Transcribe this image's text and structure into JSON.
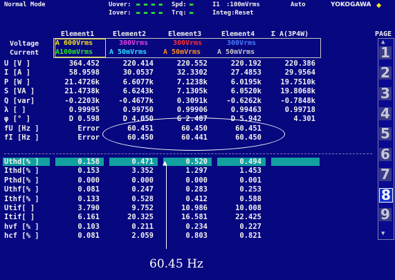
{
  "header": {
    "mode": "Normal Mode",
    "uover_label": "Uover:",
    "iover_label": "Iover:",
    "spd_label": "Spd:",
    "trq_label": "Trq:",
    "range_ch": "I1",
    "range_val": ":100mVrms",
    "auto": "Auto",
    "integ": "Integ:Reset",
    "brand": "YOKOGAWA",
    "brand_mark": "◆"
  },
  "columns": [
    "Element1",
    "Element2",
    "Element3",
    "Element4",
    "Σ A(3P4W)"
  ],
  "ranges": {
    "voltage_label": "Voltage",
    "current_label": "Current",
    "e1_v": "A 600Vrms",
    "e1_i": "A100mVrms",
    "e2_v": "300Vrms",
    "e2_i": "A 50mVrms",
    "e3_v": "300Vrms",
    "e3_i": "A 50mVrms",
    "e4_v": "300Vrms",
    "e4_i": "A 50mVrms"
  },
  "rows_top": [
    {
      "label": "U  [V  ]",
      "v": [
        "364.452",
        "220.414",
        "220.552",
        "220.192",
        "220.386"
      ]
    },
    {
      "label": "I  [A  ]",
      "v": [
        "58.9598",
        "30.0537",
        "32.3302",
        "27.4853",
        "29.9564"
      ]
    },
    {
      "label": "P  [W  ]",
      "v": [
        "21.4726k",
        "6.6077k",
        "7.1238k",
        "6.0195k",
        "19.7510k"
      ]
    },
    {
      "label": "S  [VA ]",
      "v": [
        "21.4738k",
        "6.6243k",
        "7.1305k",
        "6.0520k",
        "19.8068k"
      ]
    },
    {
      "label": "Q  [var]",
      "v": [
        "-0.2203k",
        "-0.4677k",
        "0.3091k",
        "-0.6262k",
        "-0.7848k"
      ]
    },
    {
      "label": "λ  [   ]",
      "v": [
        "0.99995",
        "0.99750",
        "0.99906",
        "0.99463",
        "0.99718"
      ]
    },
    {
      "label": "φ  [°  ]",
      "v": [
        "D   0.598",
        "D   4.050",
        "G   2.487",
        "D   5.942",
        "4.301"
      ]
    },
    {
      "label": "fU [Hz ]",
      "v": [
        "Error",
        "60.451",
        "60.450",
        "60.451",
        ""
      ]
    },
    {
      "label": "fI [Hz ]",
      "v": [
        "Error",
        "60.450",
        "60.441",
        "60.450",
        ""
      ]
    }
  ],
  "rows_bottom": [
    {
      "label": "Uthd[%  ]",
      "v": [
        "0.158",
        "0.471",
        "0.520",
        "0.494"
      ]
    },
    {
      "label": "Ithd[%  ]",
      "v": [
        "0.153",
        "3.352",
        "1.297",
        "1.453"
      ]
    },
    {
      "label": "Pthd[%  ]",
      "v": [
        "0.000",
        "0.000",
        "0.000",
        "0.001"
      ]
    },
    {
      "label": "Uthf[%  ]",
      "v": [
        "0.081",
        "0.247",
        "0.283",
        "0.253"
      ]
    },
    {
      "label": "Ithf[%  ]",
      "v": [
        "0.133",
        "0.528",
        "0.412",
        "0.588"
      ]
    },
    {
      "label": "Utif[   ]",
      "v": [
        "3.790",
        "9.752",
        "10.986",
        "10.008"
      ]
    },
    {
      "label": "Itif[   ]",
      "v": [
        "6.161",
        "20.325",
        "16.581",
        "22.425"
      ]
    },
    {
      "label": "hvf [%  ]",
      "v": [
        "0.103",
        "0.211",
        "0.234",
        "0.227"
      ]
    },
    {
      "label": "hcf [%  ]",
      "v": [
        "0.081",
        "2.059",
        "0.803",
        "0.821"
      ]
    }
  ],
  "page": {
    "label": "PAGE",
    "items": [
      "1",
      "2",
      "3",
      "4",
      "5",
      "6",
      "7",
      "8",
      "9"
    ],
    "selected": "8"
  },
  "annotation": "60.45 Hz",
  "colors": {
    "background": "#07077f",
    "green_indicator": "#2ee82e",
    "teal_bar": "#12a0a0",
    "yellow": "#f0e020",
    "magenta": "#e040e0",
    "red": "#ff3030",
    "blue": "#4a7cff",
    "cyan": "#30e0ff",
    "orange": "#ff9020"
  }
}
